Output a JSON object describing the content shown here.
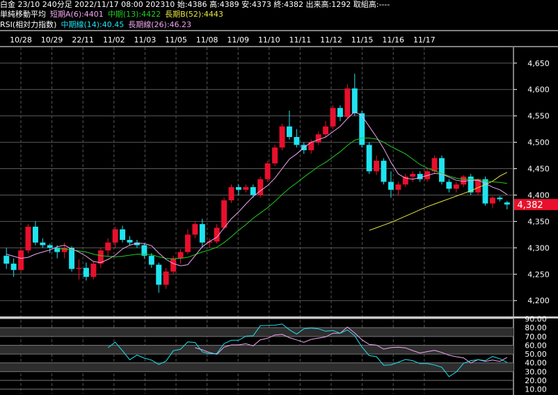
{
  "header": {
    "line1": "白金 23/10 240分足 2022/11/17 08:00 202310 始:4386 高:4389 安:4373 終:4382 出来高:1292 取組高:----",
    "ma_label": "単純移動平均",
    "ma_short": "短期A(6):4401",
    "ma_mid": "中期(13):4422",
    "ma_long": "長期B(52):4443",
    "rsi_label": "RSI(相対力指数)",
    "rsi_mid": "中期線(14):40.45",
    "rsi_long": "長期線(26):46.23"
  },
  "colors": {
    "up": "#e8102c",
    "down": "#1ee4f0",
    "ma_short": "#f0a6f0",
    "ma_mid": "#22cc22",
    "ma_long": "#e6e640",
    "price_tag": "#e8102c",
    "rsi_mid": "#1ee4f0",
    "rsi_long": "#f0a6f0"
  },
  "chart_data": [
    {
      "type": "candlestick",
      "dates": [
        "10/28",
        "10/29",
        "22/11",
        "11/02",
        "11/03",
        "11/05",
        "11/08",
        "11/09",
        "11/10",
        "11/11",
        "11/12",
        "11/15",
        "11/16",
        "11/17"
      ],
      "y_ticks": [
        "4,650",
        "4,600",
        "4,550",
        "4,500",
        "4,450",
        "4,400",
        "4,350",
        "4,300",
        "4,250",
        "4,200"
      ],
      "ylim": [
        4170,
        4680
      ],
      "last_price": "4,382",
      "ohlc": [
        [
          4285,
          4300,
          4260,
          4270
        ],
        [
          4270,
          4280,
          4245,
          4258
        ],
        [
          4258,
          4300,
          4255,
          4295
        ],
        [
          4295,
          4345,
          4290,
          4340
        ],
        [
          4340,
          4350,
          4305,
          4310
        ],
        [
          4310,
          4318,
          4300,
          4305
        ],
        [
          4305,
          4308,
          4290,
          4300
        ],
        [
          4300,
          4305,
          4280,
          4292
        ],
        [
          4292,
          4310,
          4280,
          4300
        ],
        [
          4300,
          4303,
          4255,
          4260
        ],
        [
          4260,
          4278,
          4240,
          4262
        ],
        [
          4262,
          4272,
          4238,
          4245
        ],
        [
          4245,
          4275,
          4240,
          4270
        ],
        [
          4270,
          4300,
          4262,
          4295
        ],
        [
          4295,
          4318,
          4285,
          4310
        ],
        [
          4310,
          4340,
          4300,
          4335
        ],
        [
          4335,
          4342,
          4310,
          4315
        ],
        [
          4315,
          4322,
          4305,
          4310
        ],
        [
          4310,
          4315,
          4300,
          4305
        ],
        [
          4305,
          4308,
          4280,
          4285
        ],
        [
          4285,
          4290,
          4262,
          4268
        ],
        [
          4268,
          4272,
          4215,
          4230
        ],
        [
          4230,
          4262,
          4222,
          4255
        ],
        [
          4255,
          4285,
          4250,
          4280
        ],
        [
          4280,
          4298,
          4270,
          4292
        ],
        [
          4292,
          4335,
          4288,
          4325
        ],
        [
          4325,
          4350,
          4318,
          4345
        ],
        [
          4345,
          4355,
          4300,
          4310
        ],
        [
          4310,
          4318,
          4300,
          4312
        ],
        [
          4312,
          4345,
          4308,
          4338
        ],
        [
          4338,
          4395,
          4335,
          4390
        ],
        [
          4390,
          4420,
          4385,
          4415
        ],
        [
          4415,
          4420,
          4400,
          4410
        ],
        [
          4410,
          4420,
          4405,
          4415
        ],
        [
          4415,
          4420,
          4395,
          4400
        ],
        [
          4400,
          4435,
          4395,
          4430
        ],
        [
          4430,
          4465,
          4425,
          4460
        ],
        [
          4460,
          4495,
          4455,
          4490
        ],
        [
          4490,
          4535,
          4485,
          4530
        ],
        [
          4530,
          4560,
          4505,
          4510
        ],
        [
          4510,
          4525,
          4490,
          4495
        ],
        [
          4495,
          4500,
          4478,
          4485
        ],
        [
          4485,
          4505,
          4478,
          4500
        ],
        [
          4500,
          4520,
          4495,
          4515
        ],
        [
          4515,
          4540,
          4510,
          4530
        ],
        [
          4530,
          4570,
          4525,
          4565
        ],
        [
          4565,
          4570,
          4540,
          4548
        ],
        [
          4548,
          4610,
          4545,
          4602
        ],
        [
          4602,
          4630,
          4550,
          4555
        ],
        [
          4555,
          4560,
          4490,
          4495
        ],
        [
          4495,
          4500,
          4440,
          4445
        ],
        [
          4445,
          4475,
          4438,
          4465
        ],
        [
          4465,
          4470,
          4420,
          4425
        ],
        [
          4425,
          4445,
          4395,
          4410
        ],
        [
          4410,
          4425,
          4400,
          4420
        ],
        [
          4420,
          4440,
          4415,
          4435
        ],
        [
          4435,
          4445,
          4425,
          4440
        ],
        [
          4440,
          4445,
          4425,
          4430
        ],
        [
          4430,
          4450,
          4425,
          4445
        ],
        [
          4445,
          4475,
          4440,
          4470
        ],
        [
          4470,
          4475,
          4420,
          4425
        ],
        [
          4425,
          4430,
          4405,
          4412
        ],
        [
          4412,
          4425,
          4405,
          4420
        ],
        [
          4420,
          4438,
          4415,
          4435
        ],
        [
          4435,
          4440,
          4400,
          4405
        ],
        [
          4405,
          4432,
          4400,
          4430
        ],
        [
          4430,
          4435,
          4380,
          4384
        ],
        [
          4384,
          4398,
          4375,
          4395
        ],
        [
          4395,
          4398,
          4388,
          4392
        ],
        [
          4386,
          4389,
          4373,
          4382
        ]
      ],
      "ma_short": [
        4288,
        4284,
        4280,
        4282,
        4288,
        4292,
        4296,
        4302,
        4305,
        4298,
        4292,
        4284,
        4274,
        4272,
        4278,
        4286,
        4298,
        4305,
        4309,
        4308,
        4304,
        4290,
        4278,
        4270,
        4266,
        4268,
        4285,
        4302,
        4312,
        4320,
        4338,
        4355,
        4368,
        4383,
        4397,
        4408,
        4418,
        4432,
        4450,
        4468,
        4478,
        4490,
        4500,
        4505,
        4510,
        4520,
        4530,
        4545,
        4558,
        4550,
        4530,
        4510,
        4488,
        4462,
        4440,
        4432,
        4430,
        4433,
        4437,
        4441,
        4440,
        4434,
        4428,
        4426,
        4428,
        4428,
        4422,
        4415,
        4410,
        4401
      ],
      "ma_mid": [
        null,
        null,
        null,
        null,
        null,
        null,
        null,
        4298,
        4298,
        4296,
        4294,
        4292,
        4288,
        4285,
        4284,
        4283,
        4284,
        4286,
        4288,
        4288,
        4287,
        4283,
        4280,
        4279,
        4280,
        4282,
        4287,
        4292,
        4296,
        4301,
        4310,
        4321,
        4333,
        4344,
        4356,
        4366,
        4376,
        4388,
        4401,
        4413,
        4423,
        4434,
        4444,
        4454,
        4462,
        4472,
        4482,
        4494,
        4504,
        4508,
        4508,
        4506,
        4500,
        4492,
        4485,
        4478,
        4468,
        4458,
        4451,
        4446,
        4441,
        4436,
        4432,
        4430,
        4430,
        4429,
        4427,
        4425,
        4424,
        4422
      ],
      "ma_long": [
        null,
        null,
        null,
        null,
        null,
        null,
        null,
        null,
        null,
        null,
        null,
        null,
        null,
        null,
        null,
        null,
        null,
        null,
        null,
        null,
        null,
        null,
        null,
        null,
        null,
        null,
        null,
        null,
        null,
        null,
        null,
        null,
        null,
        null,
        null,
        null,
        null,
        null,
        null,
        null,
        null,
        null,
        null,
        null,
        null,
        null,
        null,
        null,
        null,
        null,
        4333,
        4338,
        4343,
        4348,
        4354,
        4360,
        4366,
        4372,
        4378,
        4383,
        4388,
        4393,
        4398,
        4403,
        4408,
        4414,
        4420,
        4426,
        4436,
        4443
      ]
    },
    {
      "type": "line",
      "title": "RSI",
      "y_ticks": [
        "90.00",
        "80.00",
        "70.00",
        "60.00",
        "50.00",
        "40.00",
        "30.00",
        "20.00",
        "10.00"
      ],
      "ylim": [
        5,
        92
      ],
      "series": [
        {
          "name": "中期線(14)",
          "values": [
            null,
            null,
            null,
            null,
            null,
            null,
            null,
            null,
            null,
            null,
            null,
            null,
            null,
            null,
            null,
            null,
            null,
            null,
            null,
            null,
            null,
            null,
            null,
            null,
            null,
            null,
            null,
            null,
            null,
            null,
            null,
            null,
            null,
            null,
            null,
            null,
            null,
            null,
            null,
            null,
            null,
            null,
            null,
            null,
            null,
            null,
            null,
            null,
            null,
            null,
            null,
            null,
            null,
            null,
            null,
            null,
            null,
            null,
            null,
            null,
            null,
            null,
            null,
            null,
            null,
            null,
            null,
            null,
            null,
            40.45
          ]
        },
        {
          "name": "長期線(26)",
          "values": [
            null,
            null,
            null,
            null,
            null,
            null,
            null,
            null,
            null,
            null,
            null,
            null,
            null,
            null,
            null,
            null,
            null,
            null,
            null,
            null,
            null,
            null,
            null,
            null,
            null,
            null,
            null,
            null,
            null,
            null,
            null,
            null,
            null,
            null,
            null,
            null,
            null,
            null,
            null,
            null,
            null,
            null,
            null,
            null,
            null,
            null,
            null,
            null,
            null,
            null,
            null,
            null,
            null,
            null,
            null,
            null,
            null,
            null,
            null,
            null,
            null,
            null,
            null,
            null,
            null,
            null,
            null,
            null,
            null,
            46.23
          ]
        }
      ]
    }
  ]
}
